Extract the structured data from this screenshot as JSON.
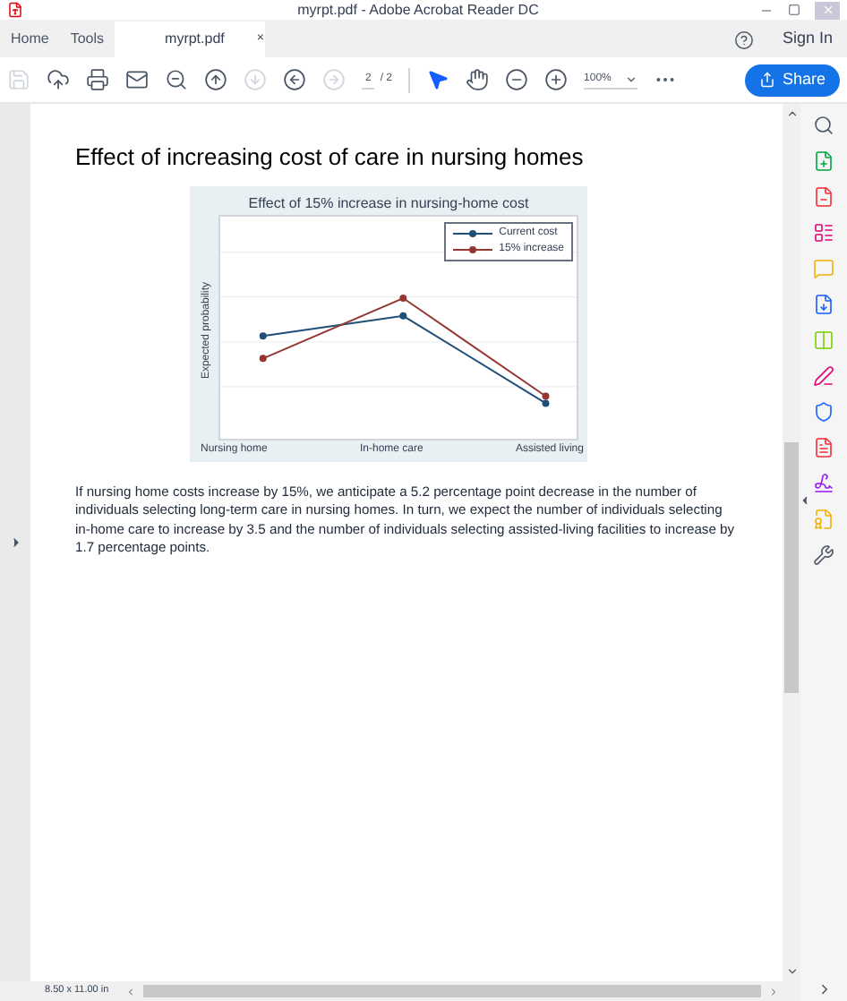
{
  "window": {
    "title": "myrpt.pdf - Adobe Acrobat Reader DC"
  },
  "tabs": [
    {
      "label": "Home",
      "selected": false
    },
    {
      "label": "Tools",
      "selected": false
    },
    {
      "label": "myrpt.pdf",
      "selected": true,
      "close": "×"
    }
  ],
  "sign_in": "Sign In",
  "toolbar": {
    "page": "2",
    "total": "/ 2",
    "zoom": "100%",
    "share": "Share"
  },
  "document": {
    "heading": "Effect of increasing cost of care in nursing homes",
    "chart": {
      "title": "Effect of 15% increase in nursing-home cost",
      "ylabel": "Expected probability",
      "categories": [
        "Nursing home",
        "In-home care",
        "Assisted living"
      ],
      "legend": [
        {
          "name": "Current cost",
          "color": "#1f4e79"
        },
        {
          "name": "15% increase",
          "color": "#943634"
        }
      ]
    },
    "paragraph": "If nursing home costs increase by 15%, we anticipate a 5.2 percentage point decrease in the number of individuals selecting long-term care in nursing homes. In turn, we expect the number of individuals selecting in-home care to increase by 3.5 and the number of individuals selecting assisted-living facilities to increase by 1.7 percentage points."
  },
  "status_bar": {
    "page_size": "8.50 x 11.00 in"
  }
}
